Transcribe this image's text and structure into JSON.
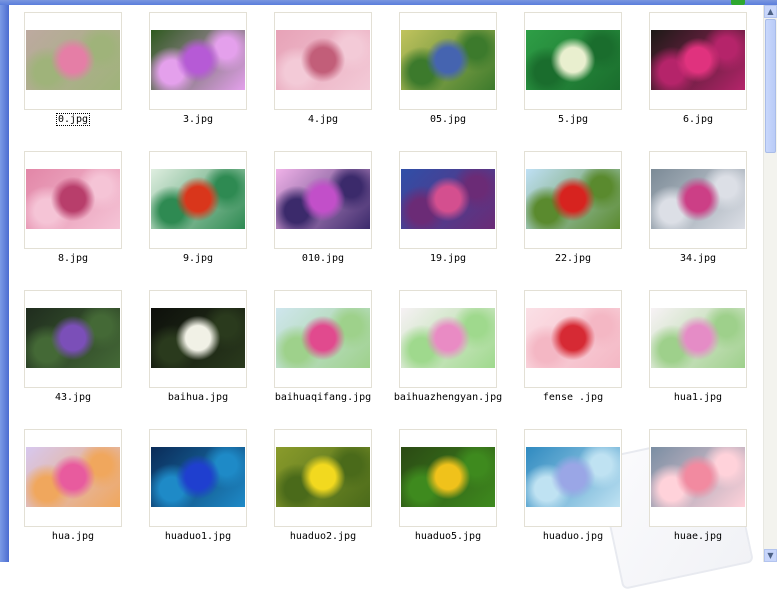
{
  "files": [
    {
      "name": "0.jpg",
      "icon": "flower-photo-thumbnail",
      "colors": [
        "#bda9a0",
        "#e57ea6",
        "#9fb37a"
      ]
    },
    {
      "name": "3.jpg",
      "icon": "flower-photo-thumbnail",
      "colors": [
        "#2f5a1f",
        "#b65ad6",
        "#e4a0ec"
      ]
    },
    {
      "name": "4.jpg",
      "icon": "flower-photo-thumbnail",
      "colors": [
        "#e7a2b7",
        "#c25e79",
        "#f3cad7"
      ]
    },
    {
      "name": "05.jpg",
      "icon": "flower-photo-thumbnail",
      "colors": [
        "#c1c35d",
        "#4564b0",
        "#3c7a2c"
      ]
    },
    {
      "name": "5.jpg",
      "icon": "flower-photo-thumbnail",
      "colors": [
        "#2e9e46",
        "#e9efcf",
        "#1a6d2d"
      ]
    },
    {
      "name": "6.jpg",
      "icon": "flower-photo-thumbnail",
      "colors": [
        "#1c1a16",
        "#e0327e",
        "#b5246a"
      ]
    },
    {
      "name": "8.jpg",
      "icon": "flower-photo-thumbnail",
      "colors": [
        "#e286a7",
        "#b83e6b",
        "#f5c4d6"
      ]
    },
    {
      "name": "9.jpg",
      "icon": "flower-photo-thumbnail",
      "colors": [
        "#dfeee0",
        "#d9361b",
        "#2e8a52"
      ]
    },
    {
      "name": "010.jpg",
      "icon": "flower-photo-thumbnail",
      "colors": [
        "#f0b2e8",
        "#c24fc9",
        "#3b2a6b"
      ]
    },
    {
      "name": "19.jpg",
      "icon": "flower-photo-thumbnail",
      "colors": [
        "#2f4fa8",
        "#d44f8f",
        "#6b2b76"
      ]
    },
    {
      "name": "22.jpg",
      "icon": "flower-photo-thumbnail",
      "colors": [
        "#bfe0f5",
        "#d7231f",
        "#5a8a2e"
      ]
    },
    {
      "name": "34.jpg",
      "icon": "flower-photo-thumbnail",
      "colors": [
        "#7b8a96",
        "#cc3f86",
        "#dcdfe6"
      ]
    },
    {
      "name": "43.jpg",
      "icon": "flower-photo-thumbnail",
      "colors": [
        "#1f2c1e",
        "#7b4fb8",
        "#446936"
      ]
    },
    {
      "name": "baihua.jpg",
      "icon": "flower-photo-thumbnail",
      "colors": [
        "#0d0f0b",
        "#f1f1e6",
        "#2a3a1d"
      ]
    },
    {
      "name": "baihuaqifang.jpg",
      "icon": "flower-photo-thumbnail",
      "colors": [
        "#cfe6ee",
        "#e14a8e",
        "#9ed18b"
      ]
    },
    {
      "name": "baihuazhengyan.jpg",
      "icon": "flower-photo-thumbnail",
      "colors": [
        "#f6f1f4",
        "#e98bc4",
        "#9fd98d"
      ]
    },
    {
      "name": "fense .jpg",
      "icon": "flower-photo-thumbnail",
      "colors": [
        "#fbe0e6",
        "#d62a34",
        "#f4b7c4"
      ]
    },
    {
      "name": "hua1.jpg",
      "icon": "flower-photo-thumbnail",
      "colors": [
        "#f7f2f5",
        "#e58cc6",
        "#9ed08b"
      ]
    },
    {
      "name": "hua.jpg",
      "icon": "flower-photo-thumbnail",
      "colors": [
        "#d7c8ef",
        "#e85b9e",
        "#f0a75d"
      ]
    },
    {
      "name": "huaduo1.jpg",
      "icon": "flower-photo-thumbnail",
      "colors": [
        "#0a2b58",
        "#1f3fcf",
        "#1e8ac7"
      ]
    },
    {
      "name": "huaduo2.jpg",
      "icon": "flower-photo-thumbnail",
      "colors": [
        "#8a9b2b",
        "#f2d91f",
        "#4a6a1a"
      ]
    },
    {
      "name": "huaduo5.jpg",
      "icon": "flower-photo-thumbnail",
      "colors": [
        "#2b4a14",
        "#f0c21b",
        "#3e8a1e"
      ]
    },
    {
      "name": "huaduo.jpg",
      "icon": "flower-photo-thumbnail",
      "colors": [
        "#2f8ac0",
        "#9aa6e6",
        "#bfe2f2"
      ]
    },
    {
      "name": "huae.jpg",
      "icon": "flower-photo-thumbnail",
      "colors": [
        "#7a8ea3",
        "#f28aa0",
        "#ffd2da"
      ]
    }
  ],
  "focused_index": 0,
  "window": {
    "status_color": "#2fa82f",
    "left_pane_color": "#5f7fd9"
  }
}
